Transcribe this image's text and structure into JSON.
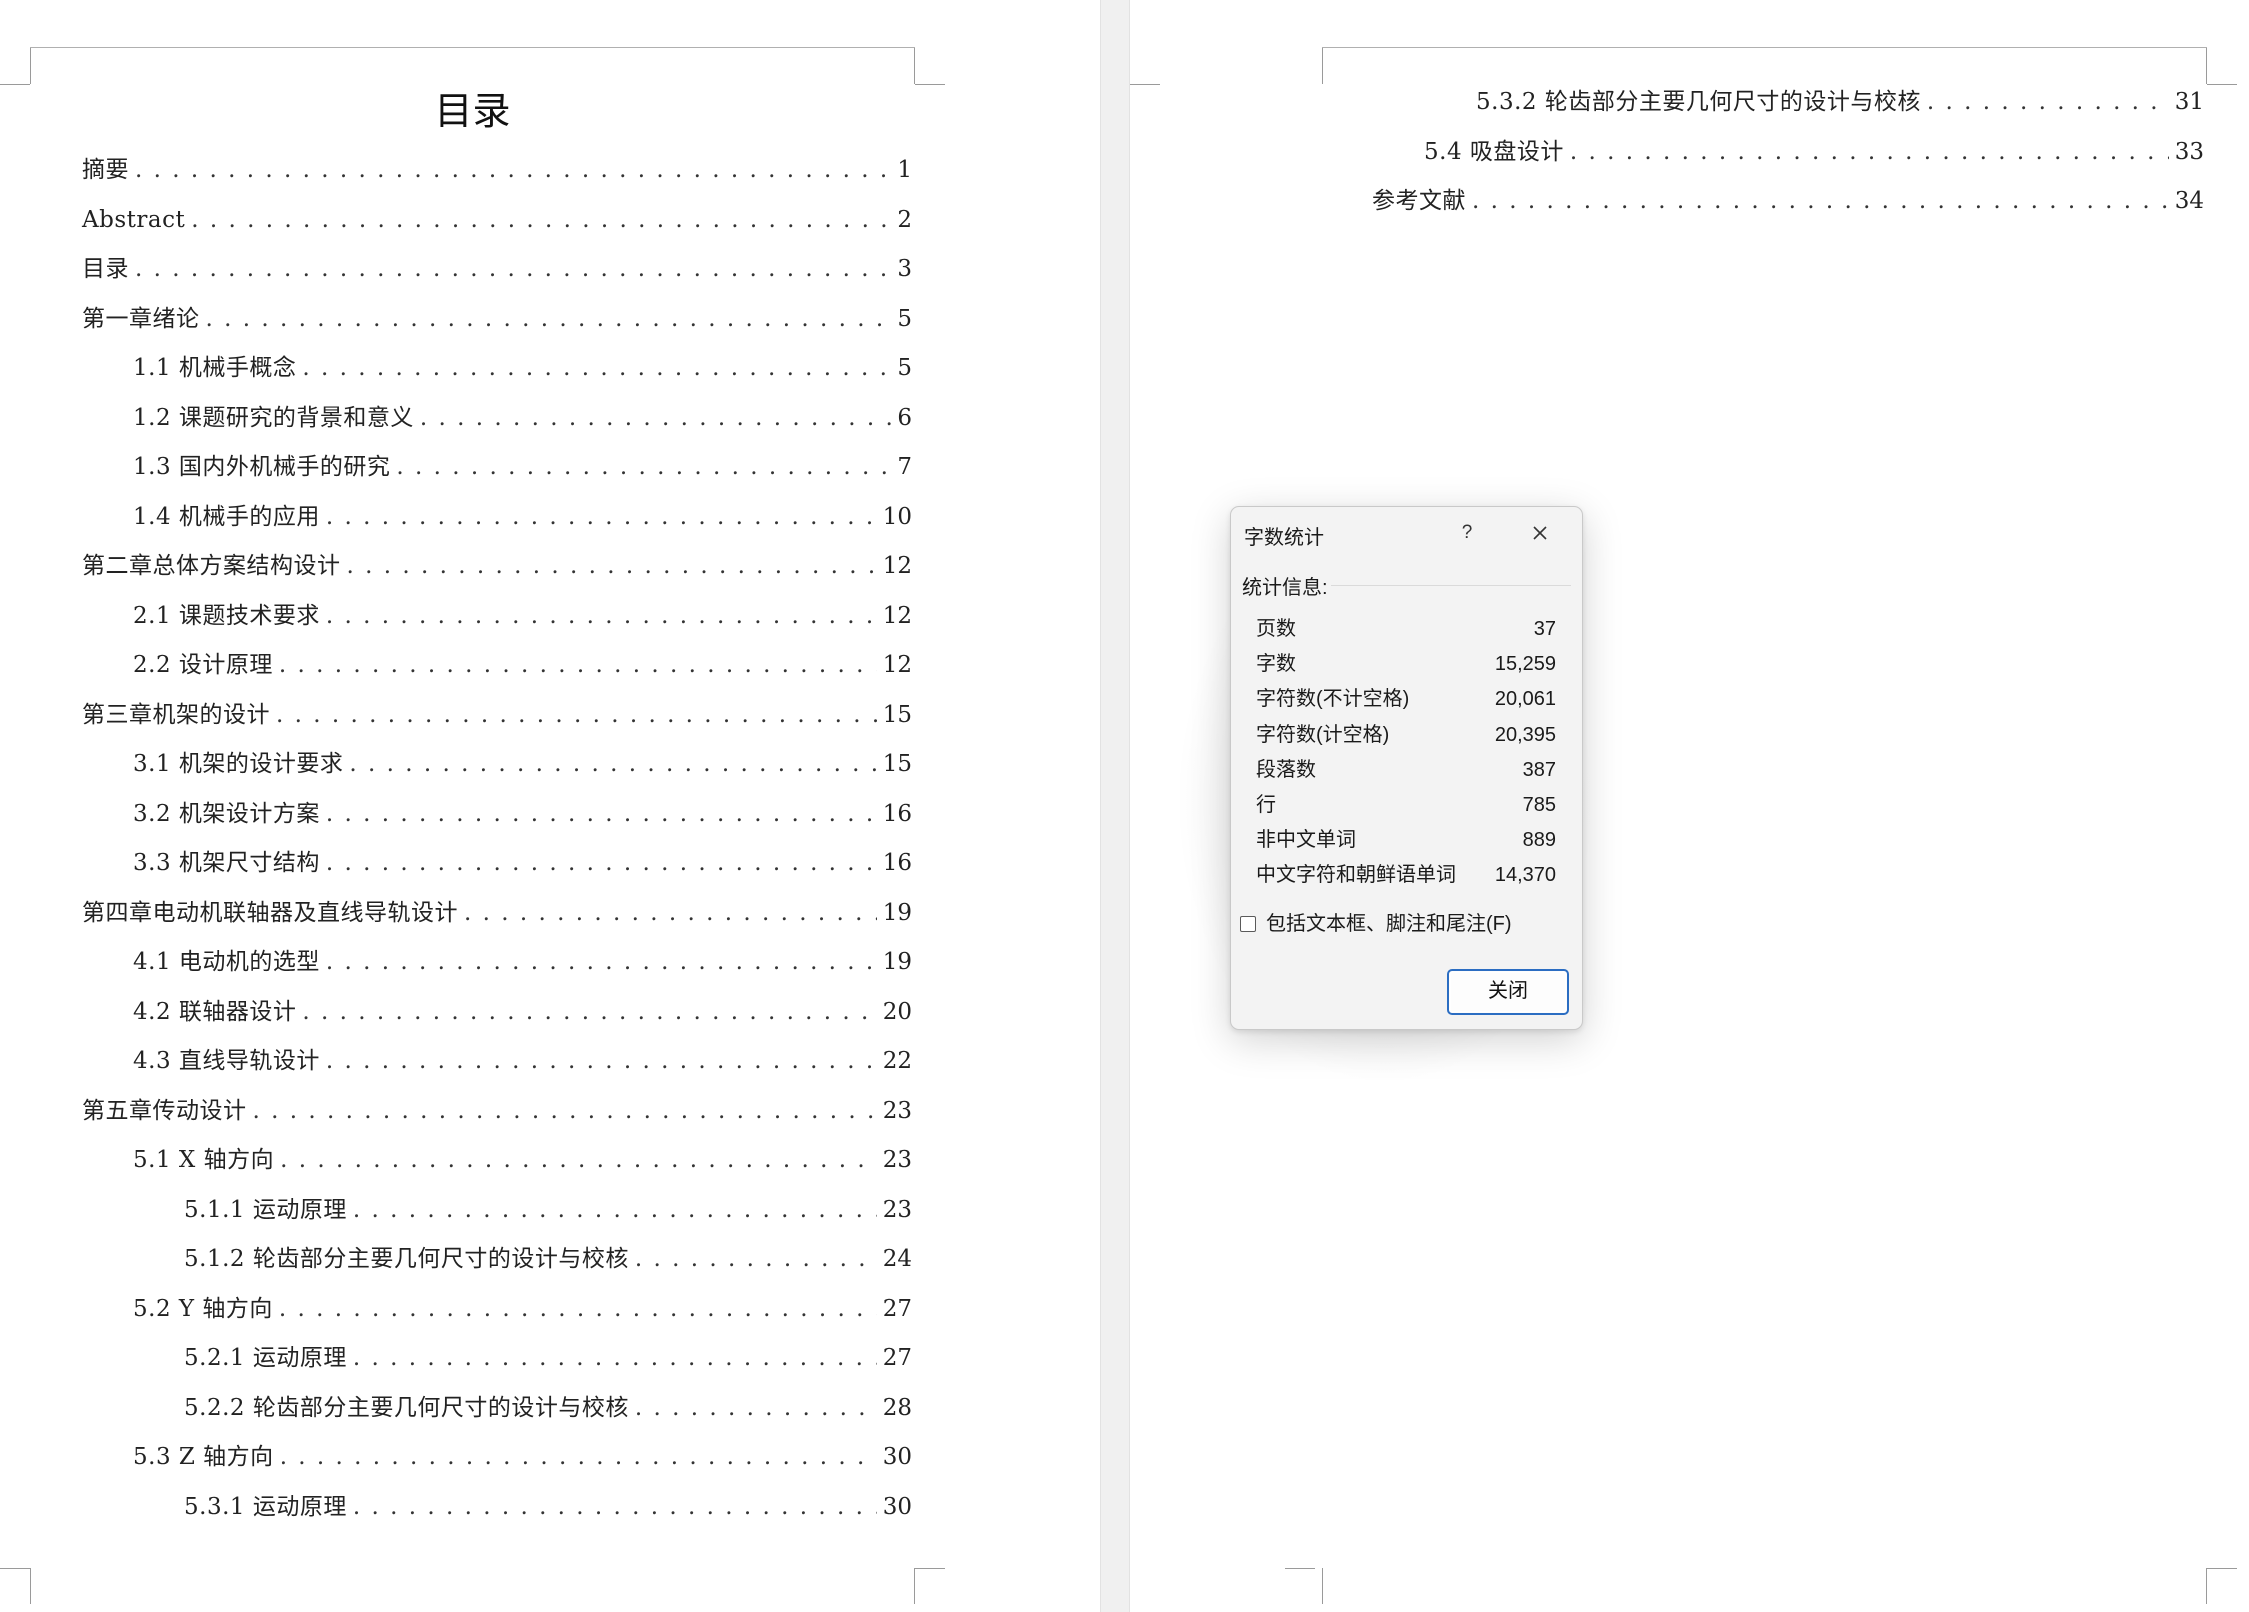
{
  "left_page": {
    "title": "目录",
    "entries": [
      {
        "text": "摘要",
        "page": "1"
      },
      {
        "text": "Abstract",
        "page": "2"
      },
      {
        "text": "目录",
        "page": "3"
      },
      {
        "text": "第一章绪论",
        "page": "5"
      },
      {
        "text": "1.1 机械手概念",
        "page": "5"
      },
      {
        "text": "1.2 课题研究的背景和意义",
        "page": "6"
      },
      {
        "text": "1.3 国内外机械手的研究",
        "page": "7"
      },
      {
        "text": "1.4 机械手的应用",
        "page": "10"
      },
      {
        "text": "第二章总体方案结构设计",
        "page": "12"
      },
      {
        "text": "2.1 课题技术要求",
        "page": "12"
      },
      {
        "text": "2.2 设计原理",
        "page": "12"
      },
      {
        "text": "第三章机架的设计",
        "page": "15"
      },
      {
        "text": "3.1 机架的设计要求",
        "page": "15"
      },
      {
        "text": "3.2 机架设计方案",
        "page": "16"
      },
      {
        "text": "3.3 机架尺寸结构",
        "page": "16"
      },
      {
        "text": "第四章电动机联轴器及直线导轨设计",
        "page": "19"
      },
      {
        "text": "4.1 电动机的选型",
        "page": "19"
      },
      {
        "text": "4.2 联轴器设计",
        "page": "20"
      },
      {
        "text": "4.3 直线导轨设计",
        "page": "22"
      },
      {
        "text": "第五章传动设计",
        "page": "23"
      },
      {
        "text": "5.1 X 轴方向",
        "page": "23"
      },
      {
        "text": "5.1.1  运动原理",
        "page": "23"
      },
      {
        "text": "5.1.2  轮齿部分主要几何尺寸的设计与校核",
        "page": "24"
      },
      {
        "text": "5.2 Y 轴方向",
        "page": "27"
      },
      {
        "text": "5.2.1 运动原理",
        "page": "27"
      },
      {
        "text": "5.2.2  轮齿部分主要几何尺寸的设计与校核",
        "page": "28"
      },
      {
        "text": "5.3 Z 轴方向",
        "page": "30"
      },
      {
        "text": "5.3.1 运动原理",
        "page": "30"
      }
    ]
  },
  "right_page": {
    "entries": [
      {
        "text": "5.3.2  轮齿部分主要几何尺寸的设计与校核",
        "page": "31"
      },
      {
        "text": "5.4  吸盘设计",
        "page": "33"
      },
      {
        "text": "参考文献",
        "page": "34"
      }
    ]
  },
  "dialog": {
    "title": "字数统计",
    "help_label": "?",
    "close_icon": "close-icon",
    "section_label": "统计信息:",
    "stats": [
      {
        "label": "页数",
        "value": "37"
      },
      {
        "label": "字数",
        "value": "15,259"
      },
      {
        "label": "字符数(不计空格)",
        "value": "20,061"
      },
      {
        "label": "字符数(计空格)",
        "value": "20,395"
      },
      {
        "label": "段落数",
        "value": "387"
      },
      {
        "label": "行",
        "value": "785"
      },
      {
        "label": "非中文单词",
        "value": "889"
      },
      {
        "label": "中文字符和朝鲜语单词",
        "value": "14,370"
      }
    ],
    "checkbox_label": "包括文本框、脚注和尾注(F)",
    "checkbox_checked": false,
    "button_label": "关闭",
    "accent_color": "#2b6dc2"
  }
}
